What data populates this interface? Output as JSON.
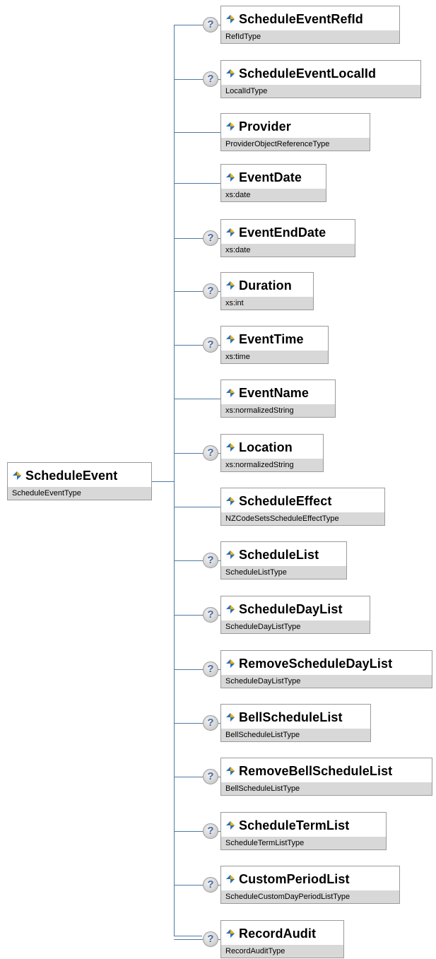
{
  "root": {
    "name": "ScheduleEvent",
    "type": "ScheduleEventType"
  },
  "optional_marker": "?",
  "connector_color": "#4f79a3",
  "icon": "xml-element-icon",
  "children": [
    {
      "name": "ScheduleEventRefId",
      "type": "RefIdType",
      "optional": true
    },
    {
      "name": "ScheduleEventLocalId",
      "type": "LocalIdType",
      "optional": true
    },
    {
      "name": "Provider",
      "type": "ProviderObjectReferenceType",
      "optional": false
    },
    {
      "name": "EventDate",
      "type": "xs:date",
      "optional": false
    },
    {
      "name": "EventEndDate",
      "type": "xs:date",
      "optional": true
    },
    {
      "name": "Duration",
      "type": "xs:int",
      "optional": true
    },
    {
      "name": "EventTime",
      "type": "xs:time",
      "optional": true
    },
    {
      "name": "EventName",
      "type": "xs:normalizedString",
      "optional": false
    },
    {
      "name": "Location",
      "type": "xs:normalizedString",
      "optional": true
    },
    {
      "name": "ScheduleEffect",
      "type": "NZCodeSetsScheduleEffectType",
      "optional": false
    },
    {
      "name": "ScheduleList",
      "type": "ScheduleListType",
      "optional": true
    },
    {
      "name": "ScheduleDayList",
      "type": "ScheduleDayListType",
      "optional": true
    },
    {
      "name": "RemoveScheduleDayList",
      "type": "ScheduleDayListType",
      "optional": true
    },
    {
      "name": "BellScheduleList",
      "type": "BellScheduleListType",
      "optional": true
    },
    {
      "name": "RemoveBellScheduleList",
      "type": "BellScheduleListType",
      "optional": true
    },
    {
      "name": "ScheduleTermList",
      "type": "ScheduleTermListType",
      "optional": true
    },
    {
      "name": "CustomPeriodList",
      "type": "ScheduleCustomDayPeriodListType",
      "optional": true
    },
    {
      "name": "RecordAudit",
      "type": "RecordAuditType",
      "optional": true
    }
  ]
}
